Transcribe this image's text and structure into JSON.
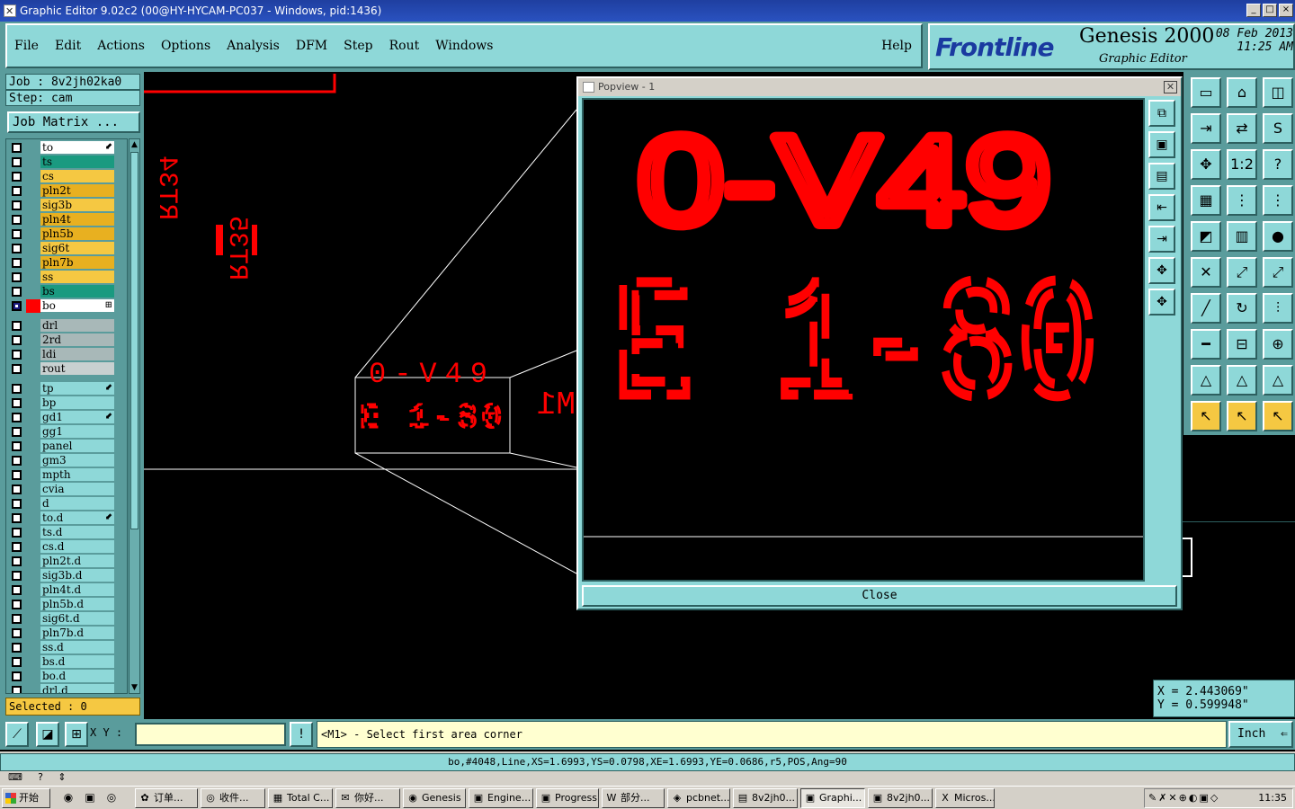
{
  "window": {
    "title": "Graphic Editor 9.02c2 (00@HY-HYCAM-PC037 - Windows, pid:1436)",
    "controls": [
      "_",
      "□",
      "×"
    ]
  },
  "menu": {
    "file": "File",
    "edit": "Edit",
    "actions": "Actions",
    "options": "Options",
    "analysis": "Analysis",
    "dfm": "DFM",
    "step": "Step",
    "rout": "Rout",
    "windows": "Windows",
    "help": "Help"
  },
  "brand": {
    "logo": "Frontline",
    "product": "Genesis 2000",
    "subtitle": "Graphic Editor",
    "date": "08 Feb 2013",
    "time": "11:25 AM"
  },
  "job": {
    "job_line": "Job : 8v2jh02ka0",
    "step_line": "Step: cam",
    "matrix_button": "Job Matrix ..."
  },
  "layers": [
    {
      "name": "to",
      "color": "#ffffff",
      "mark": "⬋"
    },
    {
      "name": "ts",
      "color": "#1a9a80"
    },
    {
      "name": "cs",
      "color": "#f5c842"
    },
    {
      "name": "pln2t",
      "color": "#e8b020"
    },
    {
      "name": "sig3b",
      "color": "#f5c842"
    },
    {
      "name": "pln4t",
      "color": "#e8b020"
    },
    {
      "name": "pln5b",
      "color": "#e8b020"
    },
    {
      "name": "sig6t",
      "color": "#f5c842"
    },
    {
      "name": "pln7b",
      "color": "#e8b020"
    },
    {
      "name": "ss",
      "color": "#f5c842"
    },
    {
      "name": "bs",
      "color": "#1a9a80"
    },
    {
      "name": "bo",
      "color": "#ffffff",
      "selected": true,
      "mark": "⊞"
    },
    {
      "name": "drl",
      "color": "#a8b8b8"
    },
    {
      "name": "2rd",
      "color": "#a8b8b8"
    },
    {
      "name": "ldi",
      "color": "#a8b8b8"
    },
    {
      "name": "rout",
      "color": "#c8d0d0"
    },
    {
      "name": "tp",
      "color": "#8ed8d8",
      "mark": "⬋"
    },
    {
      "name": "bp",
      "color": "#8ed8d8"
    },
    {
      "name": "gd1",
      "color": "#8ed8d8",
      "mark": "⬋"
    },
    {
      "name": "gg1",
      "color": "#8ed8d8"
    },
    {
      "name": "panel",
      "color": "#8ed8d8"
    },
    {
      "name": "gm3",
      "color": "#8ed8d8"
    },
    {
      "name": "mpth",
      "color": "#8ed8d8"
    },
    {
      "name": "cvia",
      "color": "#8ed8d8"
    },
    {
      "name": "d",
      "color": "#8ed8d8"
    },
    {
      "name": "to.d",
      "color": "#8ed8d8",
      "mark": "⬋"
    },
    {
      "name": "ts.d",
      "color": "#8ed8d8"
    },
    {
      "name": "cs.d",
      "color": "#8ed8d8"
    },
    {
      "name": "pln2t.d",
      "color": "#8ed8d8"
    },
    {
      "name": "sig3b.d",
      "color": "#8ed8d8"
    },
    {
      "name": "pln4t.d",
      "color": "#8ed8d8"
    },
    {
      "name": "pln5b.d",
      "color": "#8ed8d8"
    },
    {
      "name": "sig6t.d",
      "color": "#8ed8d8"
    },
    {
      "name": "pln7b.d",
      "color": "#8ed8d8"
    },
    {
      "name": "ss.d",
      "color": "#8ed8d8"
    },
    {
      "name": "bs.d",
      "color": "#8ed8d8"
    },
    {
      "name": "bo.d",
      "color": "#8ed8d8"
    },
    {
      "name": "drl.d",
      "color": "#8ed8d8"
    }
  ],
  "selected_label": "Selected : 0",
  "canvas": {
    "texts": {
      "rt34": "RT34",
      "rt35": "RT35",
      "ul_top": "0-V49",
      "ul_bottom": "E 1-80",
      "m1": "M1"
    },
    "ink_color": "#ff0000"
  },
  "popup": {
    "title": "Popview - 1",
    "close_label": "Close",
    "zoom_line1": "0-V49",
    "zoom_line2": "E 1-80"
  },
  "coords": {
    "x": "X = 2.443069\"",
    "y": "Y = 0.599948\""
  },
  "command": {
    "xy_label": "X Y :",
    "xy_value": "",
    "prompt": "<M1> - Select first area corner",
    "unit": "Inch"
  },
  "status": {
    "feature": "bo,#4048,Line,XS=1.6993,YS=0.0798,XE=1.6993,YE=0.0686,r5,POS,Ang=90"
  },
  "taskbar": {
    "start": "开始",
    "tasks": [
      {
        "label": "订单...",
        "icon": "✿"
      },
      {
        "label": "收件...",
        "icon": "◎"
      },
      {
        "label": "Total C...",
        "icon": "▦"
      },
      {
        "label": "你好...",
        "icon": "✉"
      },
      {
        "label": "Genesis",
        "icon": "◉"
      },
      {
        "label": "Engine...",
        "icon": "▣"
      },
      {
        "label": "Progress",
        "icon": "▣"
      },
      {
        "label": "部分...",
        "icon": "W"
      },
      {
        "label": "pcbnet...",
        "icon": "◈"
      },
      {
        "label": "8v2jh0...",
        "icon": "▤"
      },
      {
        "label": "Graphi...",
        "icon": "▣",
        "active": true
      },
      {
        "label": "8v2jh0...",
        "icon": "▣"
      },
      {
        "label": "Micros...",
        "icon": "X"
      }
    ],
    "clock": "11:35"
  }
}
